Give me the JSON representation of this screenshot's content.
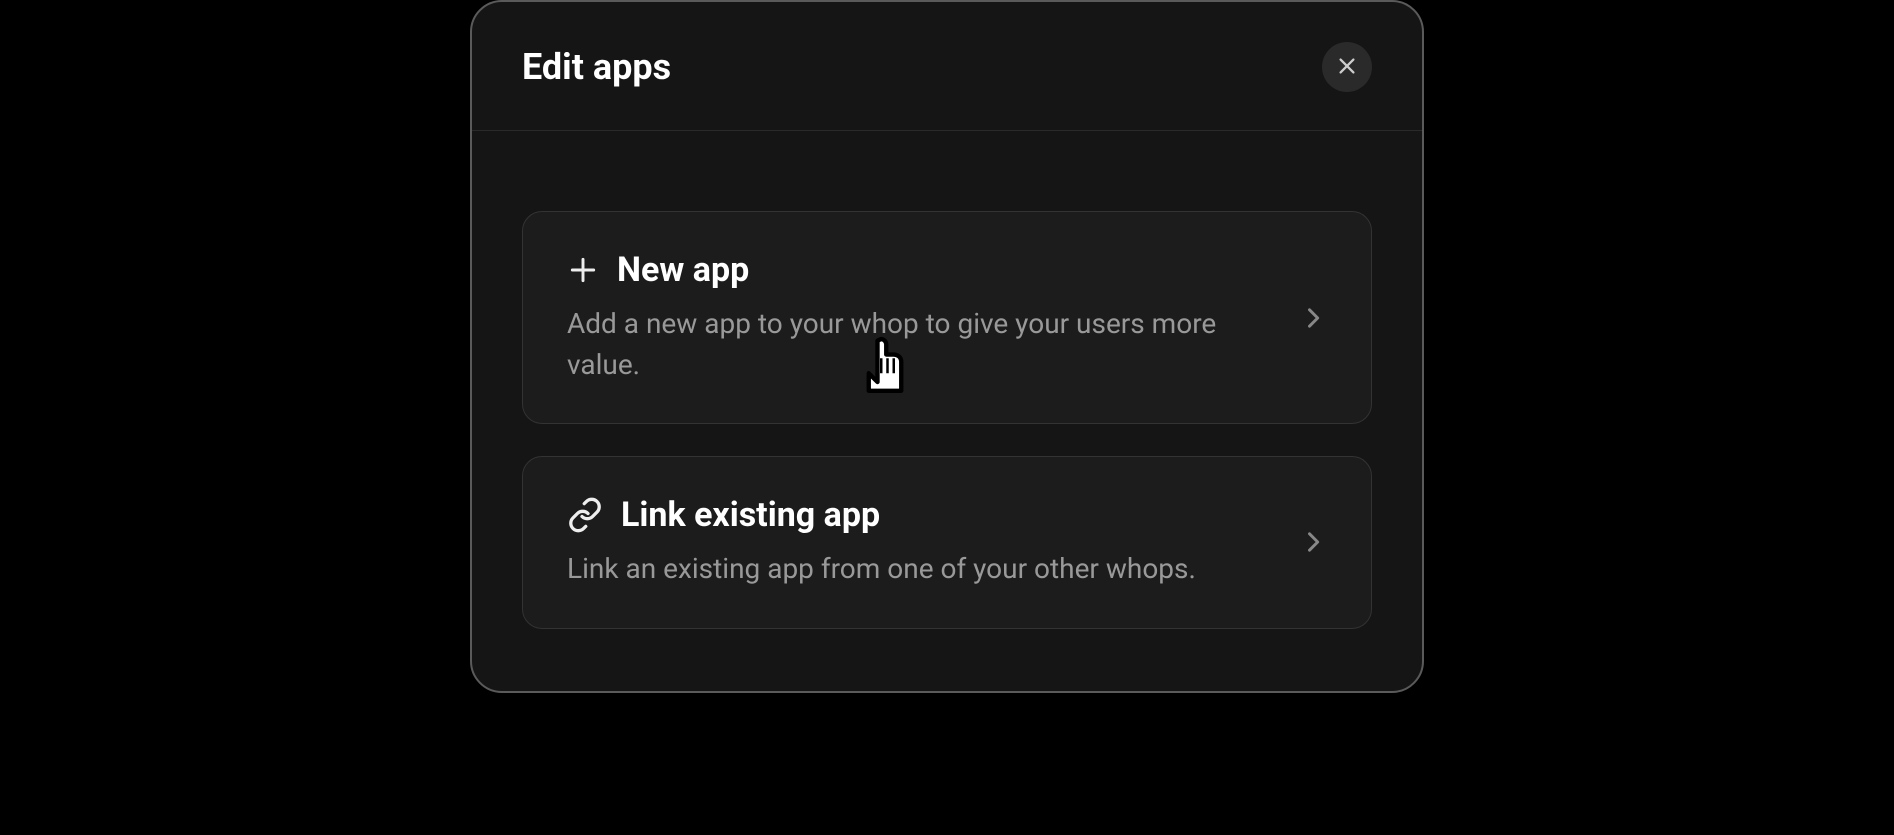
{
  "modal": {
    "title": "Edit apps",
    "options": [
      {
        "title": "New app",
        "description": "Add a new app to your whop to give your users more value."
      },
      {
        "title": "Link existing app",
        "description": "Link an existing app from one of your other whops."
      }
    ]
  }
}
